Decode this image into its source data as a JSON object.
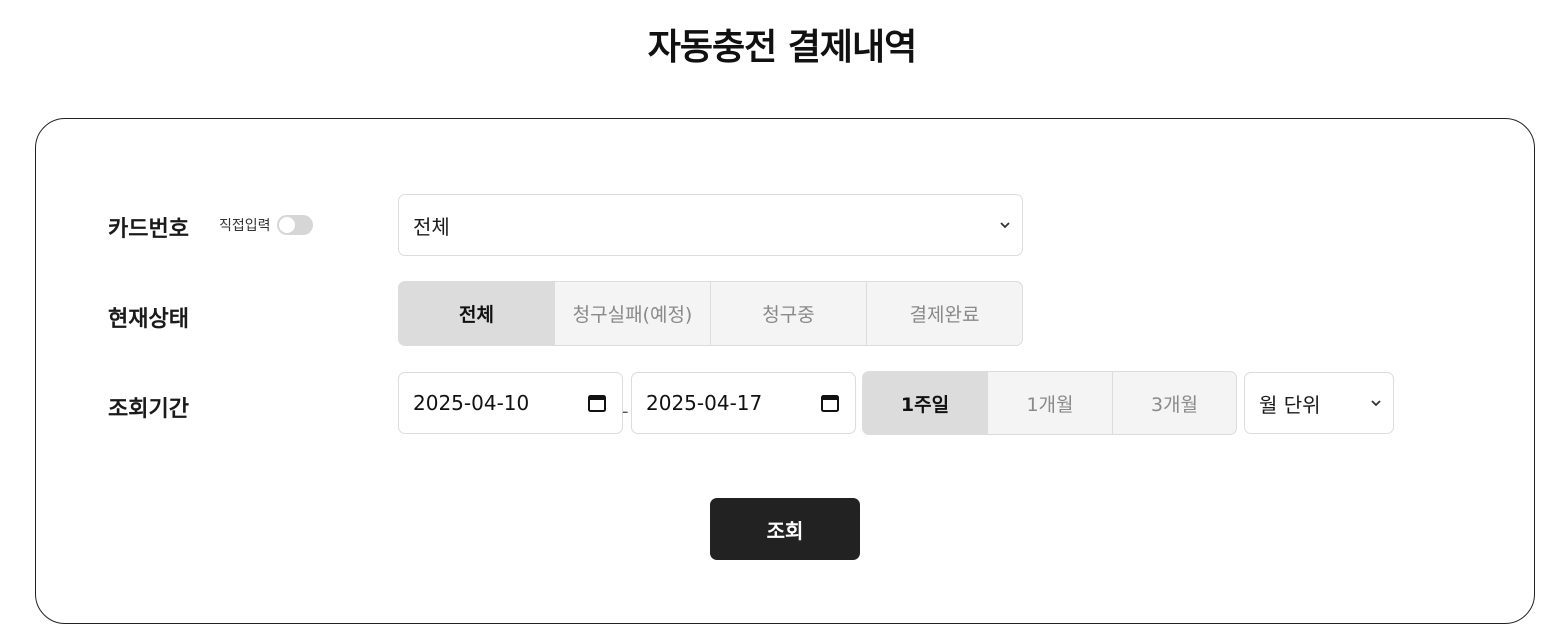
{
  "page": {
    "title": "자동충전 결제내역"
  },
  "card": {
    "label": "카드번호",
    "toggle_label": "직접입력",
    "toggle_on": false,
    "select_value": "전체"
  },
  "status": {
    "label": "현재상태",
    "options": [
      "전체",
      "청구실패(예정)",
      "청구중",
      "결제완료"
    ],
    "selected": "전체"
  },
  "period": {
    "label": "조회기간",
    "start_date": "2025-04-10",
    "end_date": "2025-04-17",
    "separator": "-",
    "ranges": [
      "1주일",
      "1개월",
      "3개월"
    ],
    "selected_range": "1주일",
    "unit_select": "월 단위"
  },
  "search_button": "조회",
  "icons": {
    "select_chevron": "chevron-down-icon",
    "calendar": "calendar-icon"
  },
  "colors": {
    "button_bg": "#222222",
    "active_segment": "#dcdcdc",
    "inactive_segment": "#f4f4f4"
  }
}
